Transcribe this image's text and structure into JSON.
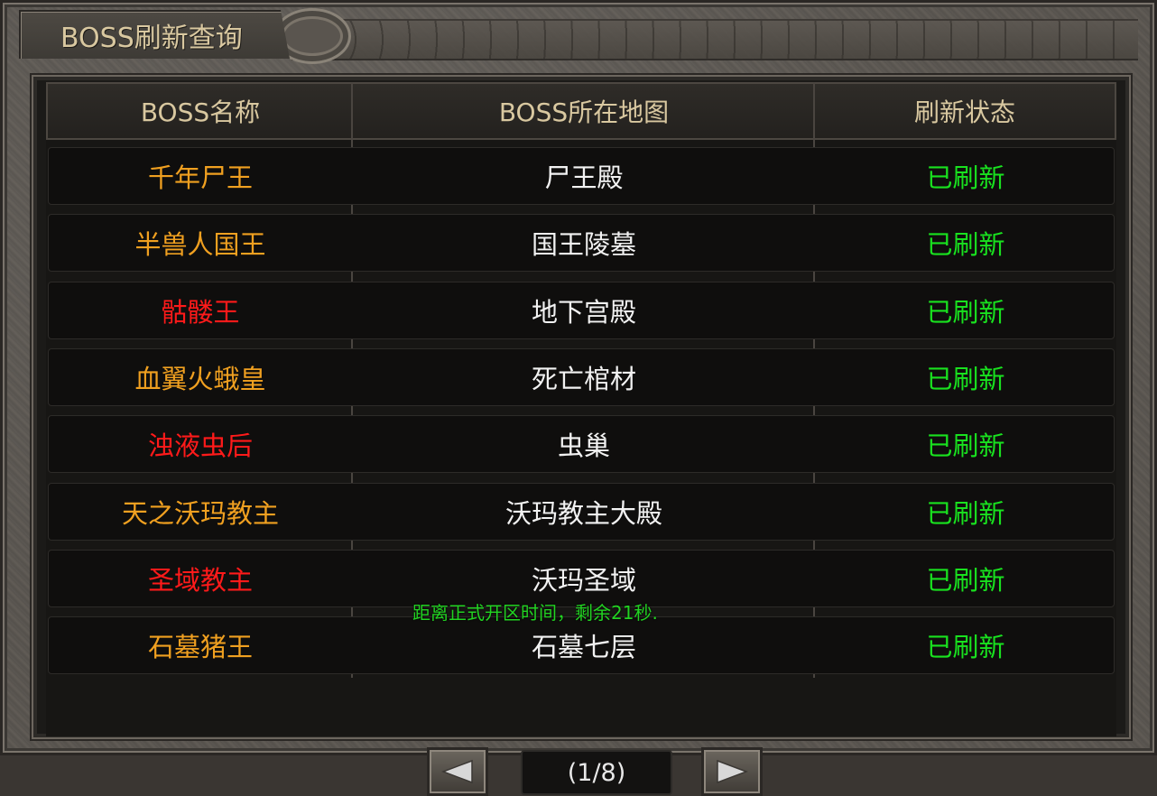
{
  "window": {
    "title": "BOSS刷新查询"
  },
  "table": {
    "headers": {
      "name": "BOSS名称",
      "map": "BOSS所在地图",
      "status": "刷新状态"
    },
    "rows": [
      {
        "name": "千年尸王",
        "name_color": "#f0a020",
        "map": "尸王殿",
        "status": "已刷新"
      },
      {
        "name": "半兽人国王",
        "name_color": "#f0a020",
        "map": "国王陵墓",
        "status": "已刷新"
      },
      {
        "name": "骷髅王",
        "name_color": "#ff1a1a",
        "map": "地下宫殿",
        "status": "已刷新"
      },
      {
        "name": "血翼火蛾皇",
        "name_color": "#f0a020",
        "map": "死亡棺材",
        "status": "已刷新"
      },
      {
        "name": "浊液虫后",
        "name_color": "#ff1a1a",
        "map": "虫巢",
        "status": "已刷新"
      },
      {
        "name": "天之沃玛教主",
        "name_color": "#f0a020",
        "map": "沃玛教主大殿",
        "status": "已刷新"
      },
      {
        "name": "圣域教主",
        "name_color": "#ff1a1a",
        "map": "沃玛圣域",
        "status": "已刷新"
      },
      {
        "name": "石墓猪王",
        "name_color": "#f0a020",
        "map": "石墓七层",
        "status": "已刷新"
      }
    ]
  },
  "notice": {
    "text": "距离正式开区时间，剩余21秒."
  },
  "pager": {
    "label": "(1/8)",
    "prev_icon": "left-arrow-icon",
    "next_icon": "right-arrow-icon"
  },
  "colors": {
    "status_green": "#19e11f",
    "gold": "#f0a020",
    "red": "#ff1a1a"
  }
}
